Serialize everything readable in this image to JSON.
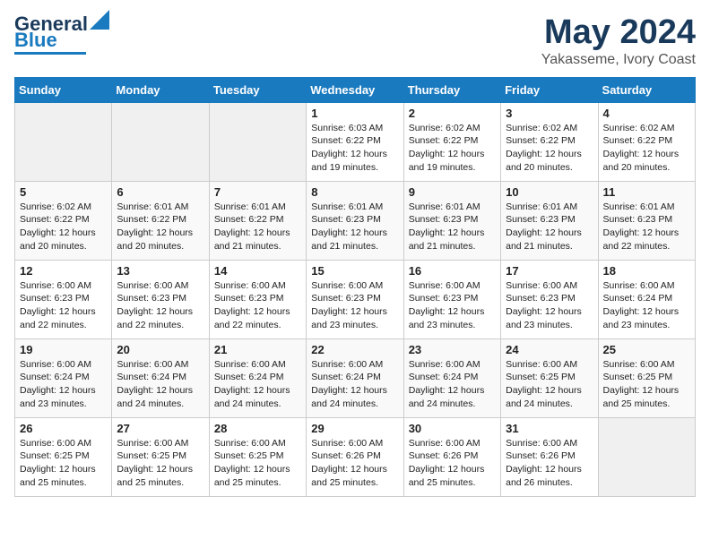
{
  "header": {
    "logo_general": "General",
    "logo_blue": "Blue",
    "month_year": "May 2024",
    "location": "Yakasseme, Ivory Coast"
  },
  "weekdays": [
    "Sunday",
    "Monday",
    "Tuesday",
    "Wednesday",
    "Thursday",
    "Friday",
    "Saturday"
  ],
  "weeks": [
    [
      {
        "day": "",
        "info": ""
      },
      {
        "day": "",
        "info": ""
      },
      {
        "day": "",
        "info": ""
      },
      {
        "day": "1",
        "info": "Sunrise: 6:03 AM\nSunset: 6:22 PM\nDaylight: 12 hours\nand 19 minutes."
      },
      {
        "day": "2",
        "info": "Sunrise: 6:02 AM\nSunset: 6:22 PM\nDaylight: 12 hours\nand 19 minutes."
      },
      {
        "day": "3",
        "info": "Sunrise: 6:02 AM\nSunset: 6:22 PM\nDaylight: 12 hours\nand 20 minutes."
      },
      {
        "day": "4",
        "info": "Sunrise: 6:02 AM\nSunset: 6:22 PM\nDaylight: 12 hours\nand 20 minutes."
      }
    ],
    [
      {
        "day": "5",
        "info": "Sunrise: 6:02 AM\nSunset: 6:22 PM\nDaylight: 12 hours\nand 20 minutes."
      },
      {
        "day": "6",
        "info": "Sunrise: 6:01 AM\nSunset: 6:22 PM\nDaylight: 12 hours\nand 20 minutes."
      },
      {
        "day": "7",
        "info": "Sunrise: 6:01 AM\nSunset: 6:22 PM\nDaylight: 12 hours\nand 21 minutes."
      },
      {
        "day": "8",
        "info": "Sunrise: 6:01 AM\nSunset: 6:23 PM\nDaylight: 12 hours\nand 21 minutes."
      },
      {
        "day": "9",
        "info": "Sunrise: 6:01 AM\nSunset: 6:23 PM\nDaylight: 12 hours\nand 21 minutes."
      },
      {
        "day": "10",
        "info": "Sunrise: 6:01 AM\nSunset: 6:23 PM\nDaylight: 12 hours\nand 21 minutes."
      },
      {
        "day": "11",
        "info": "Sunrise: 6:01 AM\nSunset: 6:23 PM\nDaylight: 12 hours\nand 22 minutes."
      }
    ],
    [
      {
        "day": "12",
        "info": "Sunrise: 6:00 AM\nSunset: 6:23 PM\nDaylight: 12 hours\nand 22 minutes."
      },
      {
        "day": "13",
        "info": "Sunrise: 6:00 AM\nSunset: 6:23 PM\nDaylight: 12 hours\nand 22 minutes."
      },
      {
        "day": "14",
        "info": "Sunrise: 6:00 AM\nSunset: 6:23 PM\nDaylight: 12 hours\nand 22 minutes."
      },
      {
        "day": "15",
        "info": "Sunrise: 6:00 AM\nSunset: 6:23 PM\nDaylight: 12 hours\nand 23 minutes."
      },
      {
        "day": "16",
        "info": "Sunrise: 6:00 AM\nSunset: 6:23 PM\nDaylight: 12 hours\nand 23 minutes."
      },
      {
        "day": "17",
        "info": "Sunrise: 6:00 AM\nSunset: 6:23 PM\nDaylight: 12 hours\nand 23 minutes."
      },
      {
        "day": "18",
        "info": "Sunrise: 6:00 AM\nSunset: 6:24 PM\nDaylight: 12 hours\nand 23 minutes."
      }
    ],
    [
      {
        "day": "19",
        "info": "Sunrise: 6:00 AM\nSunset: 6:24 PM\nDaylight: 12 hours\nand 23 minutes."
      },
      {
        "day": "20",
        "info": "Sunrise: 6:00 AM\nSunset: 6:24 PM\nDaylight: 12 hours\nand 24 minutes."
      },
      {
        "day": "21",
        "info": "Sunrise: 6:00 AM\nSunset: 6:24 PM\nDaylight: 12 hours\nand 24 minutes."
      },
      {
        "day": "22",
        "info": "Sunrise: 6:00 AM\nSunset: 6:24 PM\nDaylight: 12 hours\nand 24 minutes."
      },
      {
        "day": "23",
        "info": "Sunrise: 6:00 AM\nSunset: 6:24 PM\nDaylight: 12 hours\nand 24 minutes."
      },
      {
        "day": "24",
        "info": "Sunrise: 6:00 AM\nSunset: 6:25 PM\nDaylight: 12 hours\nand 24 minutes."
      },
      {
        "day": "25",
        "info": "Sunrise: 6:00 AM\nSunset: 6:25 PM\nDaylight: 12 hours\nand 25 minutes."
      }
    ],
    [
      {
        "day": "26",
        "info": "Sunrise: 6:00 AM\nSunset: 6:25 PM\nDaylight: 12 hours\nand 25 minutes."
      },
      {
        "day": "27",
        "info": "Sunrise: 6:00 AM\nSunset: 6:25 PM\nDaylight: 12 hours\nand 25 minutes."
      },
      {
        "day": "28",
        "info": "Sunrise: 6:00 AM\nSunset: 6:25 PM\nDaylight: 12 hours\nand 25 minutes."
      },
      {
        "day": "29",
        "info": "Sunrise: 6:00 AM\nSunset: 6:26 PM\nDaylight: 12 hours\nand 25 minutes."
      },
      {
        "day": "30",
        "info": "Sunrise: 6:00 AM\nSunset: 6:26 PM\nDaylight: 12 hours\nand 25 minutes."
      },
      {
        "day": "31",
        "info": "Sunrise: 6:00 AM\nSunset: 6:26 PM\nDaylight: 12 hours\nand 26 minutes."
      },
      {
        "day": "",
        "info": ""
      }
    ]
  ]
}
